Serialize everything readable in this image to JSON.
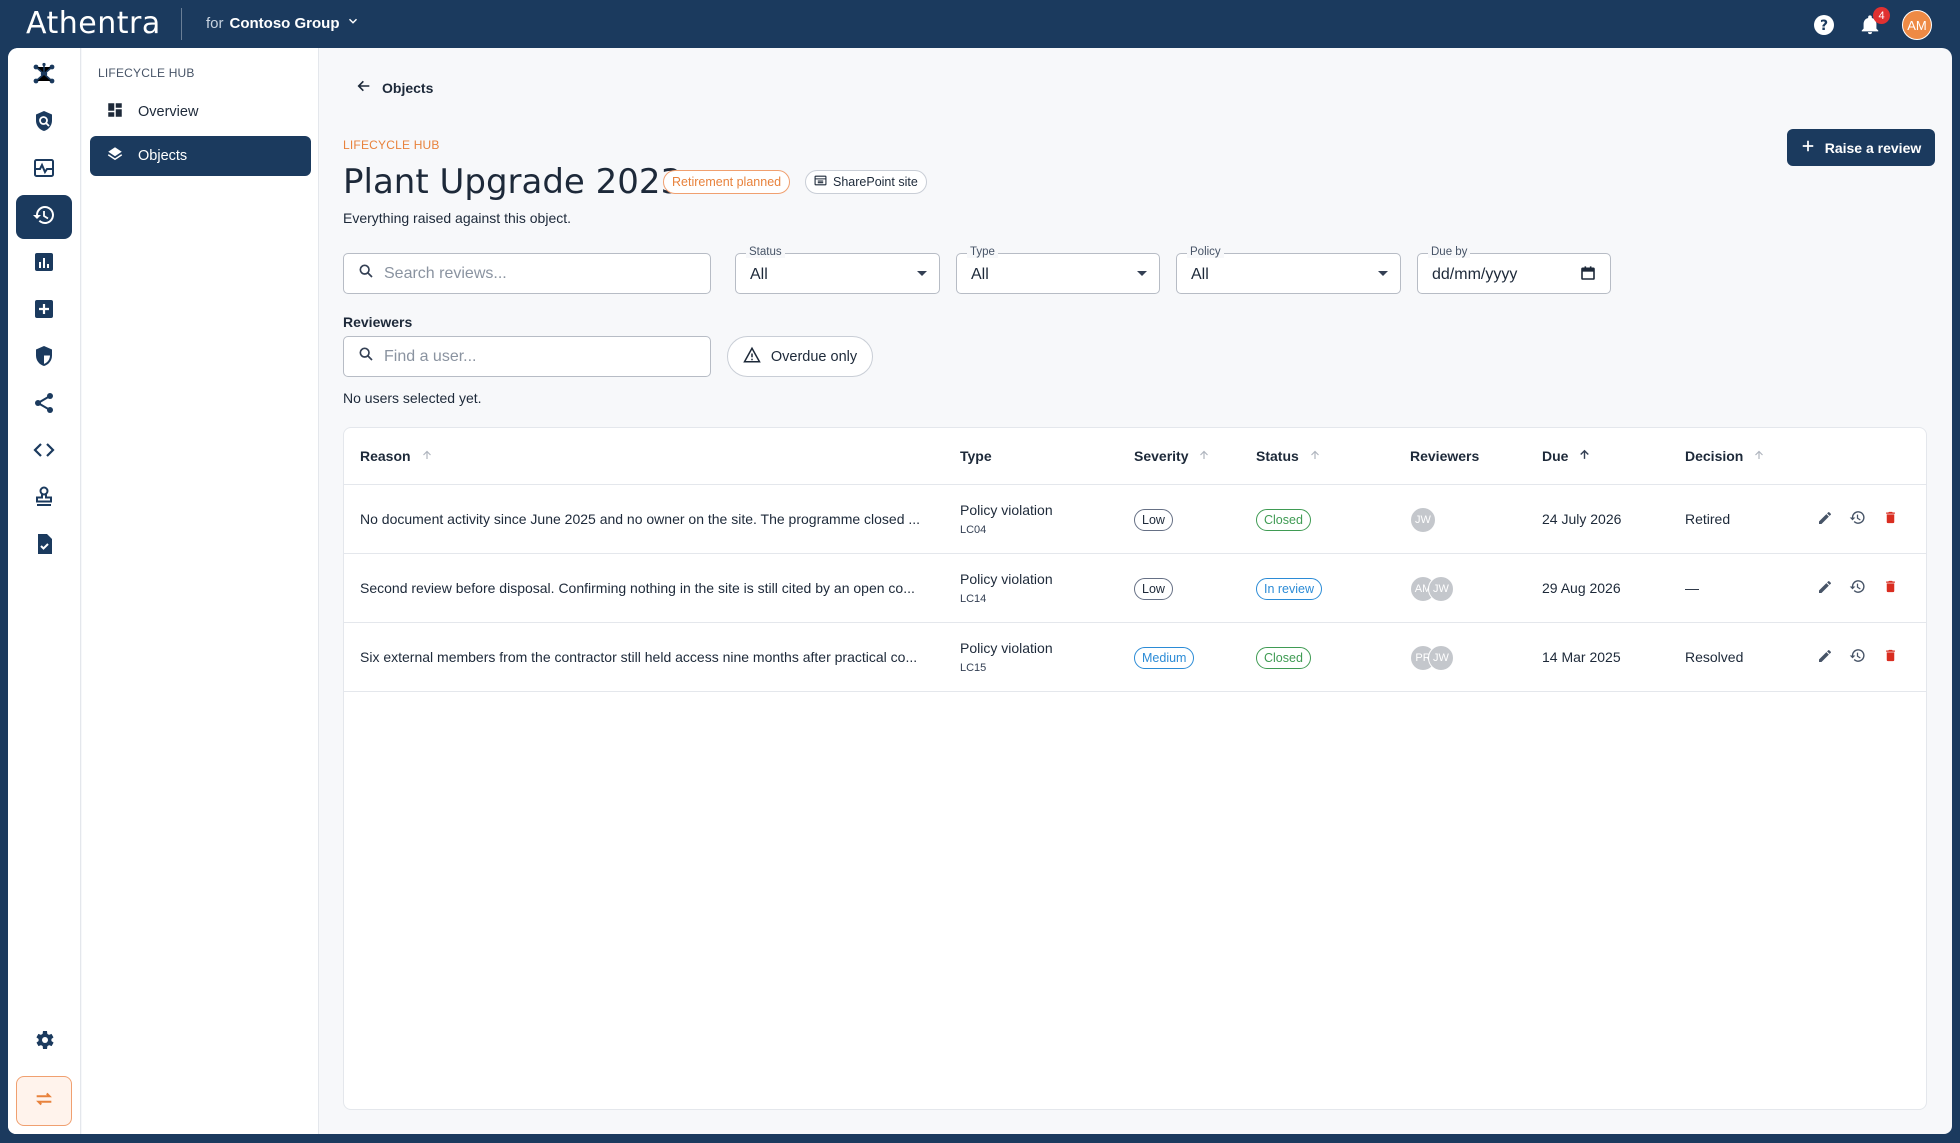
{
  "app": {
    "logo": "Athentra",
    "org_prefix": "for",
    "org_name": "Contoso Group",
    "notifications_count": "4",
    "user_initials": "AM"
  },
  "rail": {
    "items": [
      {
        "icon": "network-hub-icon"
      },
      {
        "icon": "shield-search-icon"
      },
      {
        "icon": "activity-icon"
      },
      {
        "icon": "lifecycle-history-icon",
        "active": true
      },
      {
        "icon": "bar-chart-icon"
      },
      {
        "icon": "add-box-icon"
      },
      {
        "icon": "security-shield-icon"
      },
      {
        "icon": "share-icon"
      },
      {
        "icon": "code-icon"
      },
      {
        "icon": "stamp-icon"
      },
      {
        "icon": "checklist-document-icon"
      }
    ],
    "settings_icon": "gear-icon",
    "switch_icon": "swap-icon"
  },
  "subnav": {
    "heading": "LIFECYCLE HUB",
    "items": [
      {
        "label": "Overview",
        "icon": "dashboard-icon"
      },
      {
        "label": "Objects",
        "icon": "layers-icon",
        "active": true
      }
    ]
  },
  "page": {
    "back_label": "Objects",
    "eyebrow": "LIFECYCLE HUB",
    "title": "Plant Upgrade 2023",
    "status_pill": "Retirement planned",
    "source_pill": "SharePoint site",
    "subtitle": "Everything raised against this object.",
    "raise_button": "Raise a review"
  },
  "filters": {
    "search_placeholder": "Search reviews...",
    "status": {
      "label": "Status",
      "value": "All"
    },
    "type": {
      "label": "Type",
      "value": "All"
    },
    "policy": {
      "label": "Policy",
      "value": "All"
    },
    "due_by": {
      "label": "Due by",
      "value": "dd/mm/yyyy"
    },
    "reviewers_label": "Reviewers",
    "user_placeholder": "Find a user...",
    "overdue_label": "Overdue only",
    "no_users_text": "No users selected yet."
  },
  "table": {
    "columns": [
      "Reason",
      "Type",
      "Severity",
      "Status",
      "Reviewers",
      "Due",
      "Decision"
    ],
    "rows": [
      {
        "reason": "No document activity since June 2025 and no owner on the site. The programme closed ...",
        "type": "Policy violation",
        "code": "LC04",
        "severity": "Low",
        "status": "Closed",
        "reviewers": [
          "JW"
        ],
        "due": "24 July 2026",
        "decision": "Retired"
      },
      {
        "reason": "Second review before disposal. Confirming nothing in the site is still cited by an open co...",
        "type": "Policy violation",
        "code": "LC14",
        "severity": "Low",
        "status": "In review",
        "reviewers": [
          "AM",
          "JW"
        ],
        "due": "29 Aug 2026",
        "decision": "—"
      },
      {
        "reason": "Six external members from the contractor still held access nine months after practical co...",
        "type": "Policy violation",
        "code": "LC15",
        "severity": "Medium",
        "status": "Closed",
        "reviewers": [
          "PR",
          "JW"
        ],
        "due": "14 Mar 2025",
        "decision": "Resolved"
      }
    ]
  },
  "colors": {
    "brand_navy": "#1b3a5e",
    "accent_orange": "#e8823c",
    "status_green": "#3f9b53",
    "status_blue": "#2b8bd6",
    "delete_red": "#d92d20"
  }
}
